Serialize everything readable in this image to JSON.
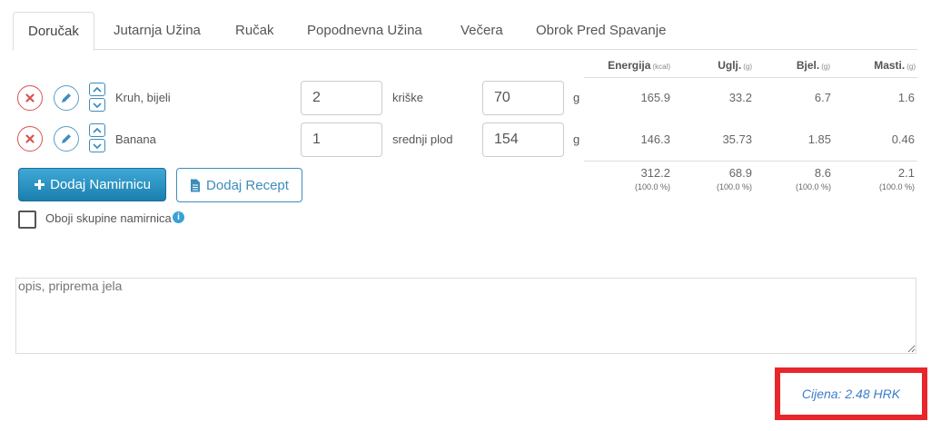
{
  "tabs": [
    {
      "label": "Doručak",
      "active": true
    },
    {
      "label": "Jutarnja Užina"
    },
    {
      "label": "Ručak"
    },
    {
      "label": "Popodnevna Užina"
    },
    {
      "label": "Večera"
    },
    {
      "label": "Obrok Pred Spavanje"
    }
  ],
  "columns": {
    "energy": {
      "label": "Energija",
      "unit": "(kcal)"
    },
    "carbs": {
      "label": "Uglj.",
      "unit": "(g)"
    },
    "protein": {
      "label": "Bjel.",
      "unit": "(g)"
    },
    "fat": {
      "label": "Masti.",
      "unit": "(g)"
    }
  },
  "items": [
    {
      "name": "Kruh, bijeli",
      "quantity": "2",
      "measure": "kriške",
      "grams": "70",
      "gram_unit": "g",
      "energy": "165.9",
      "carbs": "33.2",
      "protein": "6.7",
      "fat": "1.6"
    },
    {
      "name": "Banana",
      "quantity": "1",
      "measure": "srednji plod",
      "grams": "154",
      "gram_unit": "g",
      "energy": "146.3",
      "carbs": "35.73",
      "protein": "1.85",
      "fat": "0.46"
    }
  ],
  "totals": {
    "energy": "312.2",
    "carbs": "68.9",
    "protein": "8.6",
    "fat": "2.1",
    "energy_pct": "(100.0 %)",
    "carbs_pct": "(100.0 %)",
    "protein_pct": "(100.0 %)",
    "fat_pct": "(100.0 %)"
  },
  "buttons": {
    "add_food": "Dodaj Namirnicu",
    "add_recipe": "Dodaj Recept"
  },
  "color_groups": {
    "label": "Oboji skupine namirnica",
    "checked": false,
    "info_icon": "i"
  },
  "description": {
    "placeholder": "opis, priprema jela"
  },
  "price": "Cijena: 2.48 HRK",
  "colors": {
    "accent": "#3c8dbc",
    "delete": "#d9534f",
    "highlight": "#e8262b",
    "price": "#3d7ec9"
  }
}
